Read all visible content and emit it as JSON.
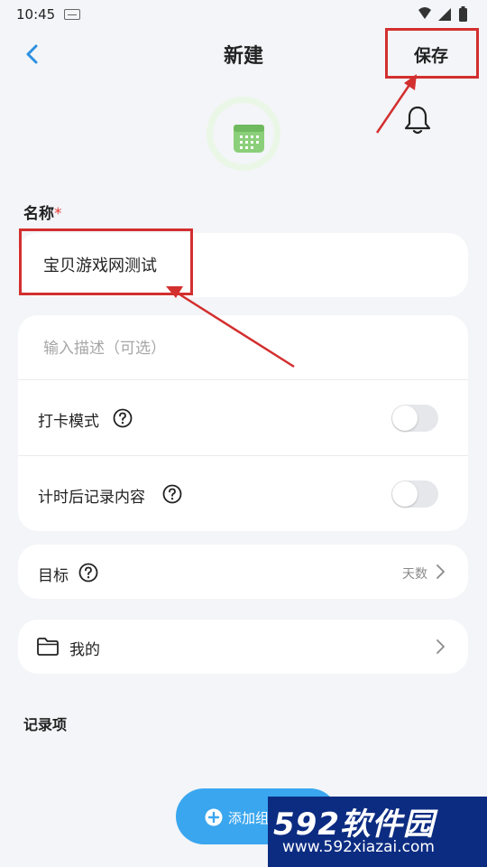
{
  "status_bar": {
    "time": "10:45"
  },
  "header": {
    "back_icon": "chevron-left-icon",
    "title": "新建",
    "save_label": "保存"
  },
  "icon_picker": {
    "icon": "calendar-icon",
    "color": "#8bcf7a"
  },
  "reminder": {
    "icon": "bell-icon"
  },
  "form": {
    "name_label": "名称",
    "required_mark": "*",
    "name_value": "宝贝游戏网测试",
    "description_placeholder": "输入描述（可选）",
    "checkin_mode_label": "打卡模式",
    "checkin_mode_enabled": false,
    "record_after_timing_label": "计时后记录内容",
    "record_after_timing_enabled": false,
    "goal_label": "目标",
    "goal_value": "天数",
    "folder_label": "我的",
    "records_label": "记录项"
  },
  "add_group": {
    "label": "添加组"
  },
  "watermark": {
    "brand": "592软件园",
    "url": "www.592xiazai.com"
  },
  "colors": {
    "accent": "#3aa6ef",
    "highlight": "#d32f2f",
    "background": "#f3f5f8"
  }
}
